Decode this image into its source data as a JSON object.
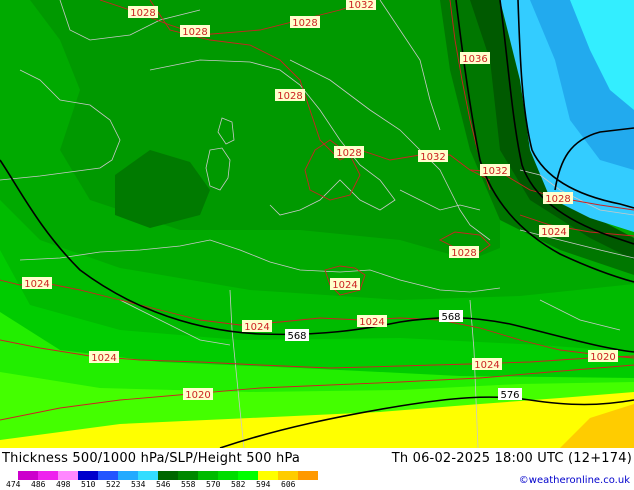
{
  "header": {
    "title_left": "Thickness 500/1000 hPa/SLP/Height 500 hPa",
    "title_right": "Th 06-02-2025 18:00 UTC (12+174)"
  },
  "credit": "©weatheronline.co.uk",
  "colorbar": {
    "ticks": [
      "474",
      "486",
      "498",
      "510",
      "522",
      "534",
      "546",
      "558",
      "570",
      "582",
      "594",
      "606"
    ],
    "colors": [
      "#cc00cc",
      "#ee22ee",
      "#ff88ff",
      "#0000cc",
      "#2255ff",
      "#22aaff",
      "#33ddff",
      "#006600",
      "#008800",
      "#00bb00",
      "#00dd00",
      "#00ff00",
      "#ffff00",
      "#ffcc00",
      "#ff9900"
    ]
  },
  "slp_labels": [
    "1028",
    "1028",
    "1028",
    "1032",
    "1036",
    "1028",
    "1028",
    "1032",
    "1032",
    "1028",
    "1024",
    "1028",
    "1024",
    "1024",
    "1024",
    "1024",
    "1024",
    "1020",
    "1020"
  ],
  "height_labels": [
    "568",
    "568",
    "576"
  ],
  "colors": {
    "slp_isobar": "#cc2222",
    "height_contour": "#000000",
    "coastline": "#c8c8c8"
  }
}
